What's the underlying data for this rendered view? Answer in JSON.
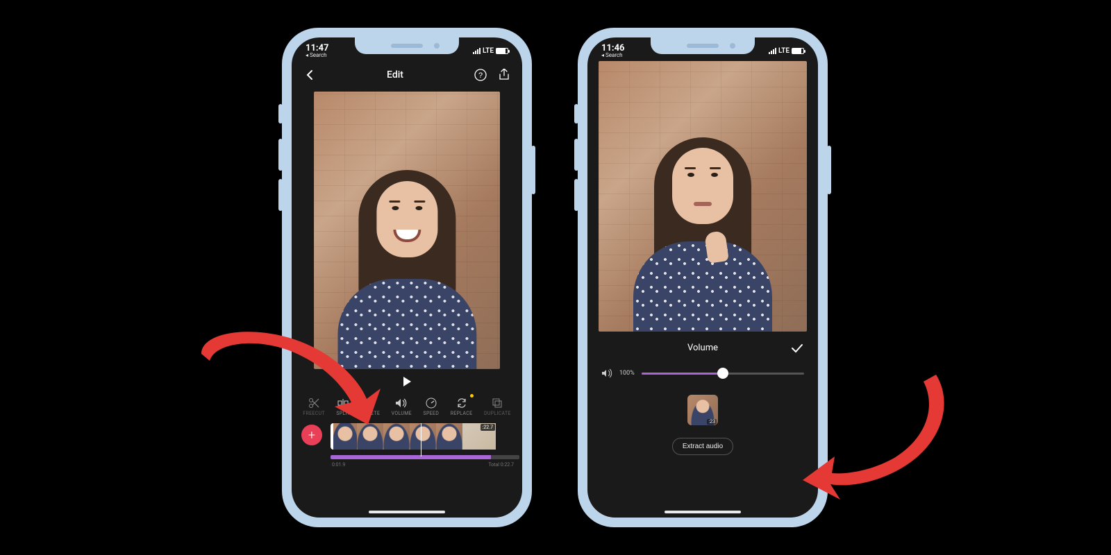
{
  "colors": {
    "phone_frame": "#bdd5eb",
    "screen_bg": "#1a1a1a",
    "accent_purple": "#a866d6",
    "add_button": "#e94057",
    "arrow_red": "#e53935",
    "indicator_yellow": "#ffcc00"
  },
  "phone_left": {
    "status": {
      "time": "11:47",
      "back_hint": "◂ Search",
      "carrier": "LTE"
    },
    "nav": {
      "title": "Edit"
    },
    "toolbar": {
      "items": [
        {
          "label": "FREECUT"
        },
        {
          "label": "SPLIT"
        },
        {
          "label": "DELETE"
        },
        {
          "label": "VOLUME"
        },
        {
          "label": "SPEED"
        },
        {
          "label": "REPLACE"
        },
        {
          "label": "DUPLICATE"
        }
      ]
    },
    "timeline": {
      "clip_duration_badge": ":22.7",
      "current_time": "0:01.9",
      "total_label": "Total 0:22.7"
    },
    "add_label": "+"
  },
  "phone_right": {
    "status": {
      "time": "11:46",
      "back_hint": "◂ Search",
      "carrier": "LTE"
    },
    "volume_panel": {
      "title": "Volume",
      "percent_label": "100%",
      "slider_percent": 50,
      "clip_duration": ":23",
      "extract_label": "Extract audio"
    }
  }
}
